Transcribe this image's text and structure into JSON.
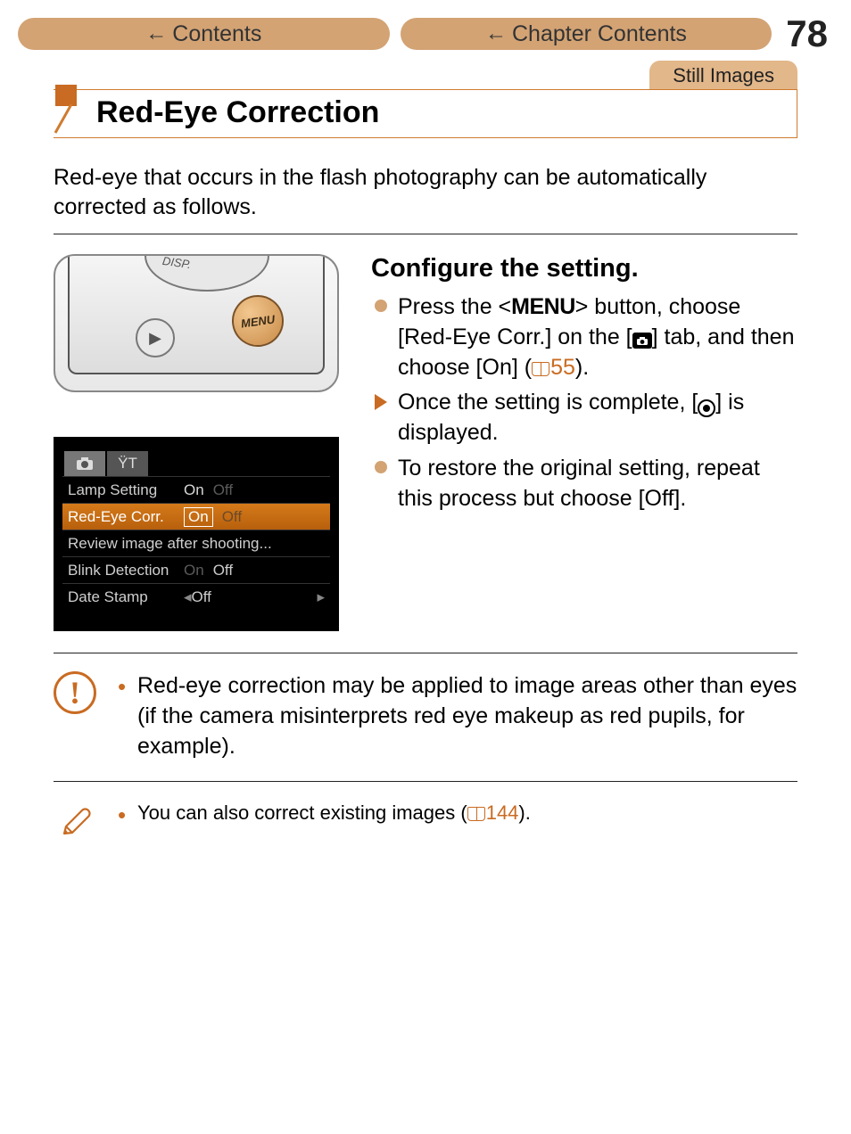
{
  "header": {
    "contents_label": "Contents",
    "chapter_contents_label": "Chapter Contents",
    "page_number": "78"
  },
  "tag": "Still Images",
  "title": "Red-Eye Correction",
  "intro": "Red-eye that occurs in the flash photography can be automatically corrected as follows.",
  "camera_illustration": {
    "menu_label": "MENU",
    "disp_label": "DISP.",
    "play_glyph": "▶"
  },
  "menu_screen": {
    "tabs": {
      "camera": "📷",
      "tools": "ŸT"
    },
    "rows": [
      {
        "label": "Lamp Setting",
        "on": "On",
        "off": "Off",
        "highlight": false
      },
      {
        "label": "Red-Eye Corr.",
        "on": "On",
        "off": "Off",
        "highlight": true
      },
      {
        "label": "Review image after shooting...",
        "on": "",
        "off": "",
        "highlight": false
      },
      {
        "label": "Blink Detection",
        "on": "On",
        "off": "Off",
        "highlight": false
      },
      {
        "label": "Date Stamp",
        "on": "",
        "off": "Off",
        "highlight": false,
        "arrow": true
      }
    ]
  },
  "right": {
    "heading": "Configure the setting.",
    "b1_a": "Press the <",
    "b1_menu": "MENU",
    "b1_b": "> button, choose [Red-Eye Corr.] on the [",
    "b1_c": "] tab, and then choose [On] (",
    "b1_ref": "55",
    "b1_d": ").",
    "b2_a": "Once the setting is complete, [",
    "b2_b": "] is displayed.",
    "b3": "To restore the original setting, repeat this process but choose [Off]."
  },
  "warning": "Red-eye correction may be applied to image areas other than eyes (if the camera misinterprets red eye makeup as red pupils, for example).",
  "tip_a": "You can also correct existing images (",
  "tip_ref": "144",
  "tip_b": ")."
}
